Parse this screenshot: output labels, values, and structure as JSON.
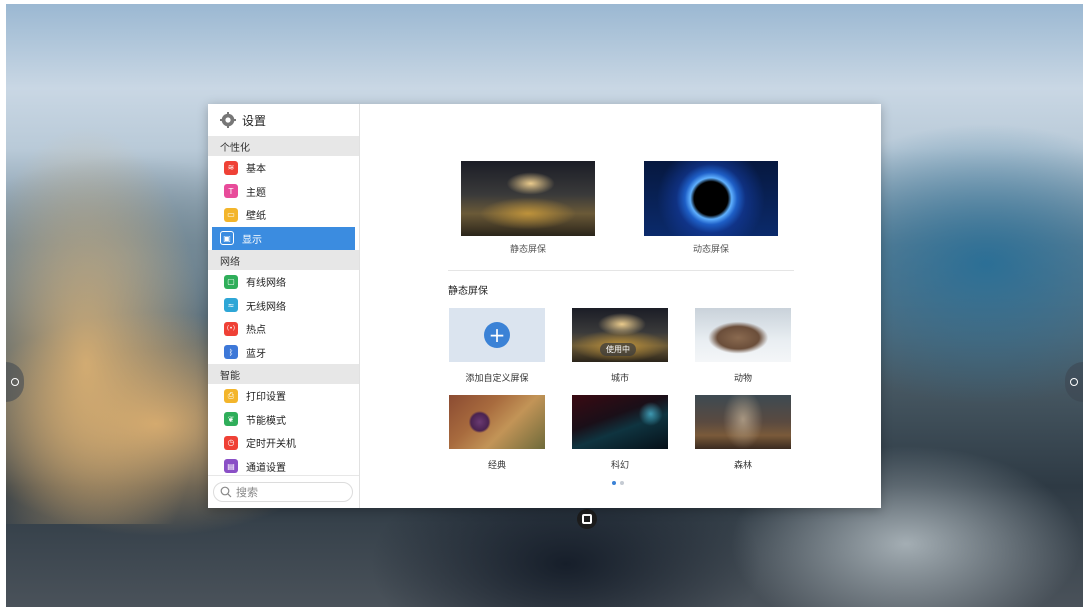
{
  "settings": {
    "title": "设置",
    "sections": [
      {
        "title": "个性化",
        "items": [
          {
            "label": "基本",
            "icon": "layers-icon",
            "color": "#ef4136",
            "glyph": "≋"
          },
          {
            "label": "主题",
            "icon": "shirt-icon",
            "color": "#e84b9a",
            "glyph": "👕"
          },
          {
            "label": "壁纸",
            "icon": "picture-icon",
            "color": "#f3b52b",
            "glyph": "▭"
          },
          {
            "label": "显示",
            "icon": "monitor-icon",
            "color": "#3b8ce0",
            "glyph": "▣",
            "active": true
          }
        ]
      },
      {
        "title": "网络",
        "items": [
          {
            "label": "有线网络",
            "icon": "ethernet-icon",
            "color": "#2fae5a",
            "glyph": "▢"
          },
          {
            "label": "无线网络",
            "icon": "wifi-icon",
            "color": "#2ea6d6",
            "glyph": "≈"
          },
          {
            "label": "热点",
            "icon": "hotspot-icon",
            "color": "#ef4136",
            "glyph": "((•))"
          },
          {
            "label": "蓝牙",
            "icon": "bluetooth-icon",
            "color": "#3d78d8",
            "glyph": "ᛒ"
          }
        ]
      },
      {
        "title": "智能",
        "items": [
          {
            "label": "打印设置",
            "icon": "printer-icon",
            "color": "#f3b52b",
            "glyph": "⎙"
          },
          {
            "label": "节能模式",
            "icon": "leaf-icon",
            "color": "#2fae5a",
            "glyph": "❦"
          },
          {
            "label": "定时开关机",
            "icon": "clock-icon",
            "color": "#ef4136",
            "glyph": "◷"
          },
          {
            "label": "通道设置",
            "icon": "channel-icon",
            "color": "#8a4fc6",
            "glyph": "▤"
          }
        ]
      }
    ],
    "search_placeholder": "搜索"
  },
  "screensaver": {
    "mode_static_label": "静态屏保",
    "mode_dynamic_label": "动态屏保",
    "section_title": "静态屏保",
    "add_label": "添加自定义屏保",
    "in_use_badge": "使用中",
    "tiles": [
      "城市",
      "动物",
      "经典",
      "科幻",
      "森林"
    ],
    "pages": 2,
    "current_page": 1
  },
  "colors": {
    "accent": "#3b8ce0",
    "add_tile_bg": "#dbe4ef"
  }
}
